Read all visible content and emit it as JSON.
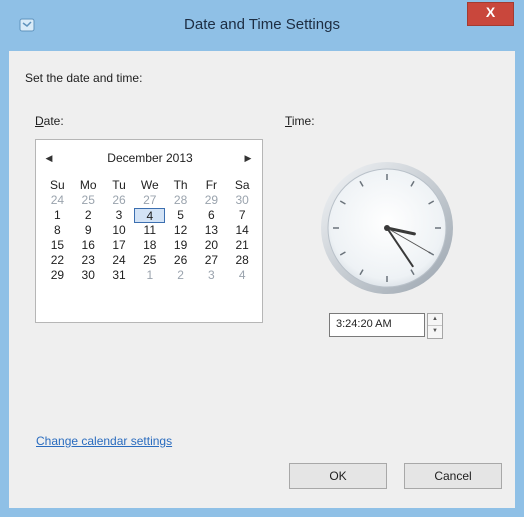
{
  "window": {
    "title": "Date and Time Settings",
    "close_glyph": "X"
  },
  "instructions": "Set the date and time:",
  "date_label": "Date:",
  "date_label_key": "D",
  "date_label_rest": "ate:",
  "time_label_key": "T",
  "time_label_rest": "ime:",
  "calendar": {
    "month_year": "December 2013",
    "prev_icon": "◀",
    "next_icon": "▶",
    "day_headers": [
      "Su",
      "Mo",
      "Tu",
      "We",
      "Th",
      "Fr",
      "Sa"
    ],
    "weeks": [
      [
        "24",
        "25",
        "26",
        "27",
        "28",
        "29",
        "30"
      ],
      [
        "1",
        "2",
        "3",
        "4",
        "5",
        "6",
        "7"
      ],
      [
        "8",
        "9",
        "10",
        "11",
        "12",
        "13",
        "14"
      ],
      [
        "15",
        "16",
        "17",
        "18",
        "19",
        "20",
        "21"
      ],
      [
        "22",
        "23",
        "24",
        "25",
        "26",
        "27",
        "28"
      ],
      [
        "29",
        "30",
        "31",
        "1",
        "2",
        "3",
        "4"
      ]
    ],
    "selected_day": "4"
  },
  "clock": {
    "hours": 3,
    "minutes": 24,
    "seconds": 20
  },
  "time_value": "3:24:20 AM",
  "spin_up": "▲",
  "spin_down": "▼",
  "change_calendar_link": "Change calendar settings",
  "ok_label": "OK",
  "cancel_label": "Cancel",
  "colors": {
    "titlebar": "#8fc0e6",
    "close_button": "#c9473c",
    "link": "#2a6cbf"
  }
}
